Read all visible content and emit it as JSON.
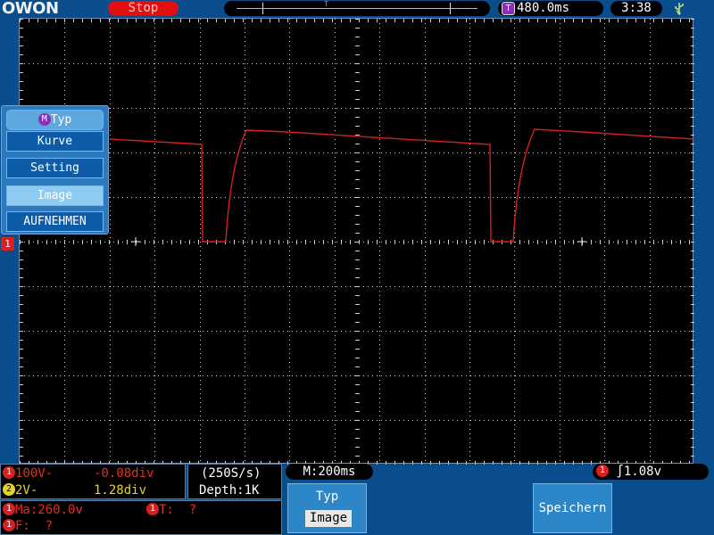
{
  "header": {
    "brand": "OWON",
    "run_status": "Stop",
    "trigger_position_marker": "T",
    "trigger_time_icon": "T",
    "trigger_time": "480.0ms",
    "clock": "3:38",
    "usb_icon": "usb-icon"
  },
  "screen": {
    "channel_marker": "1",
    "trace_color": "#d81e1e",
    "grid_color": "#cfcfcf"
  },
  "menu": {
    "icon": "M",
    "title": "Typ",
    "items": [
      {
        "label": "Kurve"
      },
      {
        "label": "Setting"
      },
      {
        "label": "Image"
      },
      {
        "label": "AUFNEHMEN"
      }
    ],
    "active_item": "Image"
  },
  "status": {
    "ch1": {
      "num": "1",
      "scale": "100V-",
      "offset": "-0.08div"
    },
    "ch2": {
      "num": "2",
      "scale": "2V-",
      "offset": "1.28div"
    },
    "sample_rate": "(250S/s)",
    "depth": "Depth:1K",
    "timebase": "M:200ms",
    "trigger": {
      "channel": "1",
      "edge_symbol": "∫",
      "level": "1.08v"
    },
    "measure": {
      "ma_channel": "1",
      "ma": "Ma:260.0v",
      "t_channel": "1",
      "t": "T:  ?",
      "f_channel": "1",
      "f": "F:  ?"
    }
  },
  "softkeys": {
    "typ_label": "Typ",
    "typ_value": "Image",
    "save_label": "Speichern"
  }
}
